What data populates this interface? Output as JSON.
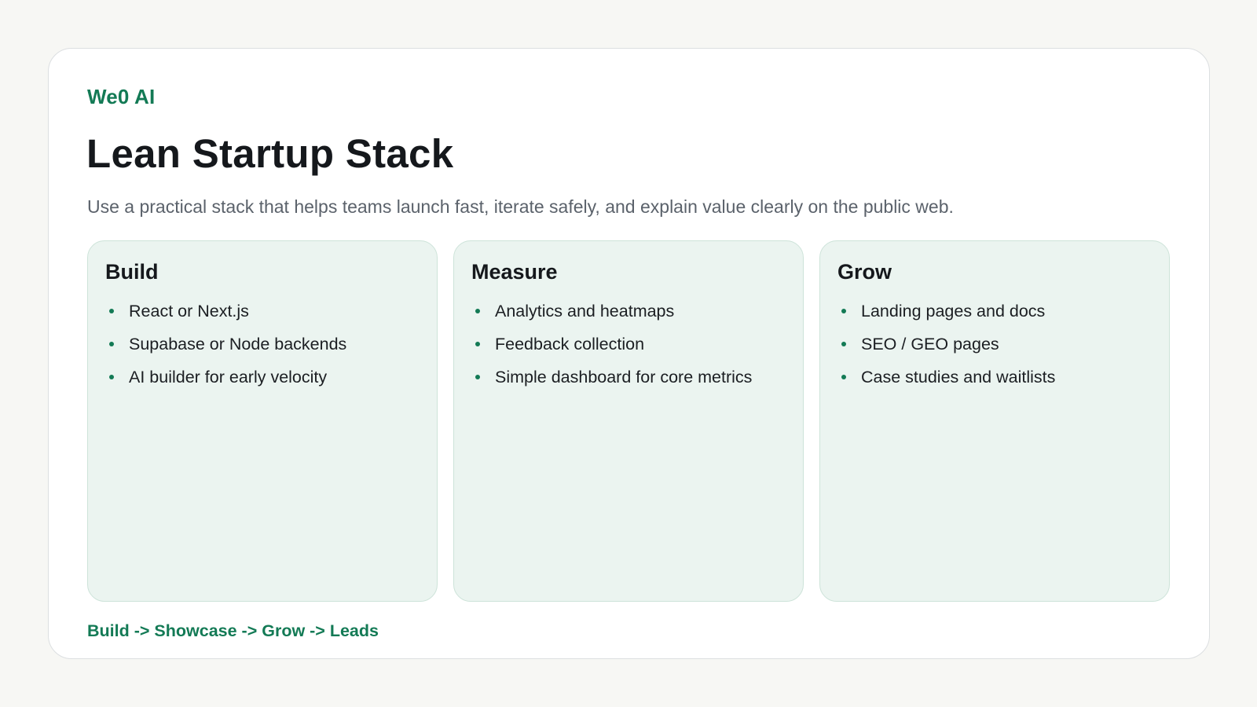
{
  "brand": "We0 AI",
  "title": "Lean Startup Stack",
  "subtitle": "Use a practical stack that helps teams launch fast, iterate safely, and explain value clearly on the public web.",
  "cards": [
    {
      "title": "Build",
      "items": [
        "React or Next.js",
        "Supabase or Node backends",
        "AI builder for early velocity"
      ]
    },
    {
      "title": "Measure",
      "items": [
        "Analytics and heatmaps",
        "Feedback collection",
        "Simple dashboard for core metrics"
      ]
    },
    {
      "title": "Grow",
      "items": [
        "Landing pages and docs",
        "SEO / GEO pages",
        "Case studies and waitlists"
      ]
    }
  ],
  "flow": "Build -> Showcase -> Grow -> Leads",
  "colors": {
    "accent": "#137a55",
    "card_background": "#ebf4f0",
    "page_background": "#f7f7f4"
  }
}
